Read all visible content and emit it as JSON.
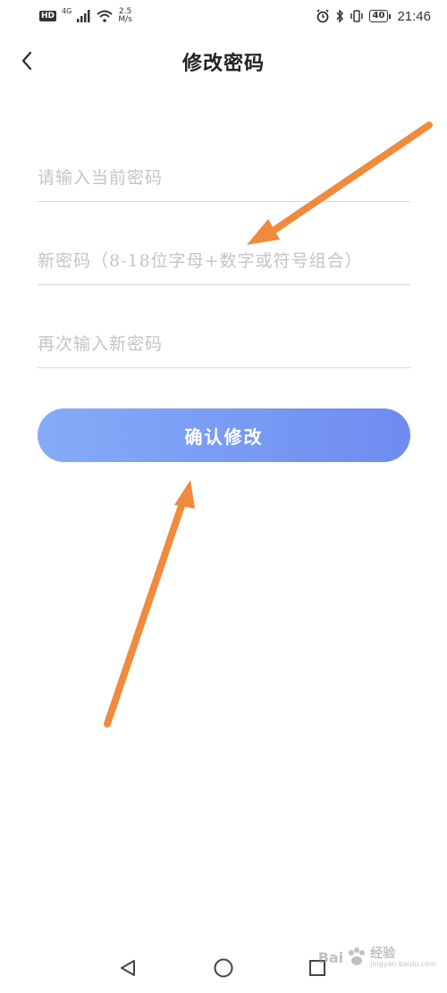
{
  "status_bar": {
    "hd": "HD",
    "network": "4G",
    "speed_value": "2.5",
    "speed_unit": "M/s",
    "battery": "40",
    "time": "21:46"
  },
  "header": {
    "title": "修改密码",
    "back_icon": "chevron-left-icon"
  },
  "form": {
    "current_password_placeholder": "请输入当前密码",
    "new_password_placeholder": "新密码（8-18位字母+数字或符号组合）",
    "repeat_password_placeholder": "再次输入新密码",
    "current_password_value": "",
    "new_password_value": "",
    "repeat_password_value": ""
  },
  "confirm_button": {
    "label": "确认修改",
    "gradient_start": "#84acf8",
    "gradient_end": "#6f8bf0"
  },
  "annotation": {
    "arrow_color": "#f08a3c"
  },
  "nav_bar": {
    "back_icon": "triangle-back-icon",
    "home_icon": "circle-home-icon",
    "recent_icon": "square-recent-icon"
  },
  "watermark": {
    "brand": "Bai",
    "sub1": "经验",
    "sub2": "jingyan.baidu.com"
  }
}
